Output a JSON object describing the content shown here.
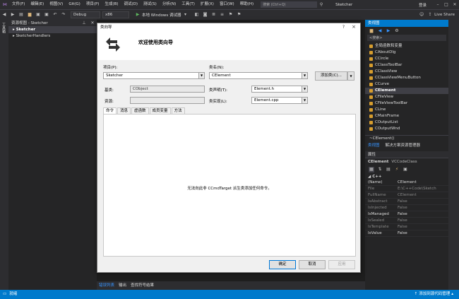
{
  "menu": {
    "items": [
      "文件(F)",
      "编辑(E)",
      "视图(V)",
      "Git(G)",
      "项目(P)",
      "生成(B)",
      "调试(D)",
      "测试(S)",
      "分析(N)",
      "工具(T)",
      "扩展(X)",
      "窗口(W)",
      "帮助(H)"
    ],
    "search_placeholder": "搜索 (Ctrl+Q)",
    "solution_name": "Sketcher",
    "login": "登录",
    "live_share": "Live Share"
  },
  "toolbar": {
    "config": "Debug",
    "platform": "x86",
    "run_label": "本地 Windows 调试器"
  },
  "left_panel": {
    "strip_label": "工具箱",
    "header": "资源视图 - Sketcher",
    "items": [
      {
        "label": "Sketcher",
        "selected": true
      },
      {
        "label": "SketcherHandlers",
        "selected": false
      }
    ]
  },
  "editor_tabs": [
    "错误列表",
    "输出",
    "查找符号结果"
  ],
  "dialog": {
    "title": "类向导",
    "help": "?",
    "close": "×",
    "heading": "欢迎使用类向导",
    "project_label": "项目(P):",
    "project_value": "Sketcher",
    "classname_label": "类名(N):",
    "classname_value": "CElement",
    "add_class": "添加类(C)...",
    "base_label": "基类:",
    "base_value": "CObject",
    "header_label": "类声明(T):",
    "header_value": "Element.h",
    "resource_label": "资源:",
    "resource_value": "",
    "impl_label": "类实现(L):",
    "impl_value": "Element.cpp",
    "tabs": [
      {
        "label": "命令",
        "active": true
      },
      {
        "label": "消息",
        "active": false
      },
      {
        "label": "虚函数",
        "active": false
      },
      {
        "label": "成员变量",
        "active": false
      },
      {
        "label": "方法",
        "active": false
      }
    ],
    "empty_message": "无法向此非 CCmdTarget 派生类添加任何命令。",
    "ok": "确定",
    "cancel": "取消",
    "apply": "应用"
  },
  "class_view": {
    "header": "类视图",
    "search_placeholder": "<搜索>",
    "items": [
      {
        "label": "全局函数和变量",
        "selected": false
      },
      {
        "label": "CAboutDlg",
        "selected": false
      },
      {
        "label": "CCircle",
        "selected": false
      },
      {
        "label": "CClassToolBar",
        "selected": false
      },
      {
        "label": "CClassView",
        "selected": false
      },
      {
        "label": "CClassViewMenuButton",
        "selected": false
      },
      {
        "label": "CCurve",
        "selected": false
      },
      {
        "label": "CElement",
        "selected": true
      },
      {
        "label": "CFileView",
        "selected": false
      },
      {
        "label": "CFileViewToolBar",
        "selected": false
      },
      {
        "label": "CLine",
        "selected": false
      },
      {
        "label": "CMainFrame",
        "selected": false
      },
      {
        "label": "COutputList",
        "selected": false
      },
      {
        "label": "COutputWnd",
        "selected": false
      }
    ],
    "member": "~CElement()",
    "tab1": "类视图",
    "tab2": "解决方案资源管理器"
  },
  "properties": {
    "header": "属性",
    "object": "CElement",
    "object_type": "VCCodeClass",
    "section": "C++",
    "rows": [
      {
        "key": "(Name)",
        "value": "CElement",
        "dim": false
      },
      {
        "key": "File",
        "value": "E:\\C++Code\\Sketch",
        "dim": true
      },
      {
        "key": "FullName",
        "value": "CElement",
        "dim": true
      },
      {
        "key": "IsAbstract",
        "value": "False",
        "dim": true
      },
      {
        "key": "IsInjected",
        "value": "False",
        "dim": true
      },
      {
        "key": "IsManaged",
        "value": "False",
        "dim": false
      },
      {
        "key": "IsSealed",
        "value": "False",
        "dim": true
      },
      {
        "key": "IsTemplate",
        "value": "False",
        "dim": true
      },
      {
        "key": "IsValue",
        "value": "False",
        "dim": false
      }
    ]
  },
  "status": {
    "left": "就绪",
    "right": "添加到源代码管理"
  }
}
